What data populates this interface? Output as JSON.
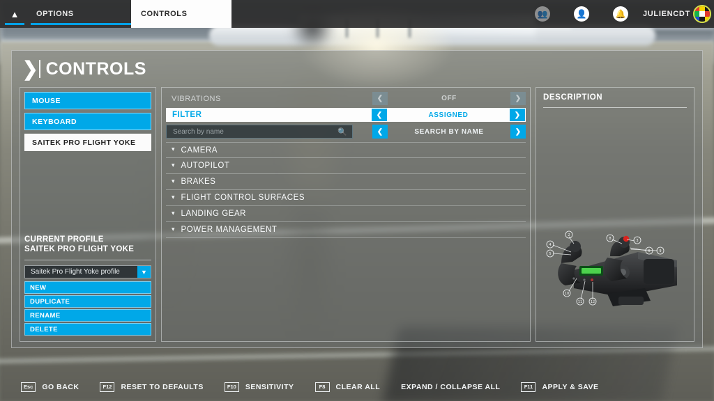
{
  "topbar": {
    "home_icon": "home-icon",
    "tabs": [
      {
        "label": "OPTIONS",
        "active": true
      },
      {
        "label": "CONTROLS",
        "active": true
      }
    ],
    "friends_icon": "friends-icon",
    "profile_icon": "person-icon",
    "notifications_icon": "bell-icon",
    "username": "JULIENCDT",
    "avatar_icon": "avatar-icon"
  },
  "page": {
    "chevron_icon": "chevron-right-icon",
    "title": "CONTROLS"
  },
  "devices": [
    {
      "label": "MOUSE",
      "selected": false
    },
    {
      "label": "KEYBOARD",
      "selected": false
    },
    {
      "label": "SAITEK PRO FLIGHT YOKE",
      "selected": true
    }
  ],
  "profile": {
    "heading_line1": "CURRENT PROFILE",
    "heading_line2": "SAITEK PRO FLIGHT YOKE",
    "select_value": "Saitek Pro Flight Yoke profile",
    "select_caret_icon": "chevron-down-icon",
    "actions": [
      {
        "label": "NEW"
      },
      {
        "label": "DUPLICATE"
      },
      {
        "label": "RENAME"
      },
      {
        "label": "DELETE"
      }
    ]
  },
  "settings": {
    "vibrations": {
      "label": "VIBRATIONS",
      "value": "OFF",
      "prev_icon": "chevron-left-icon",
      "next_icon": "chevron-right-icon"
    },
    "filter": {
      "label": "FILTER",
      "value": "ASSIGNED",
      "prev_icon": "chevron-left-icon",
      "next_icon": "chevron-right-icon"
    },
    "search": {
      "placeholder": "Search by name",
      "value": "",
      "search_icon": "magnifier-icon",
      "mode_value": "SEARCH BY NAME",
      "prev_icon": "chevron-left-icon",
      "next_icon": "chevron-right-icon"
    }
  },
  "categories": [
    {
      "label": "CAMERA",
      "caret_icon": "chevron-down-icon"
    },
    {
      "label": "AUTOPILOT",
      "caret_icon": "chevron-down-icon"
    },
    {
      "label": "BRAKES",
      "caret_icon": "chevron-down-icon"
    },
    {
      "label": "FLIGHT CONTROL SURFACES",
      "caret_icon": "chevron-down-icon"
    },
    {
      "label": "LANDING GEAR",
      "caret_icon": "chevron-down-icon"
    },
    {
      "label": "POWER MANAGEMENT",
      "caret_icon": "chevron-down-icon"
    }
  ],
  "description": {
    "title": "DESCRIPTION",
    "device_image_icon": "flight-yoke-diagram",
    "callouts": [
      "2",
      "4",
      "5",
      "8",
      "3",
      "6",
      "9",
      "10",
      "11",
      "12"
    ]
  },
  "shortcuts": [
    {
      "key": "Esc",
      "label": "GO BACK"
    },
    {
      "key": "F12",
      "label": "RESET TO DEFAULTS"
    },
    {
      "key": "F10",
      "label": "SENSITIVITY"
    },
    {
      "key": "F8",
      "label": "CLEAR ALL"
    },
    {
      "key": "",
      "label": "EXPAND / COLLAPSE ALL"
    },
    {
      "key": "F11",
      "label": "APPLY & SAVE"
    }
  ],
  "colors": {
    "accent": "#00a8e8",
    "panel": "#6c7070",
    "topbar": "#2e2e2e",
    "white": "#fdfdfd"
  }
}
